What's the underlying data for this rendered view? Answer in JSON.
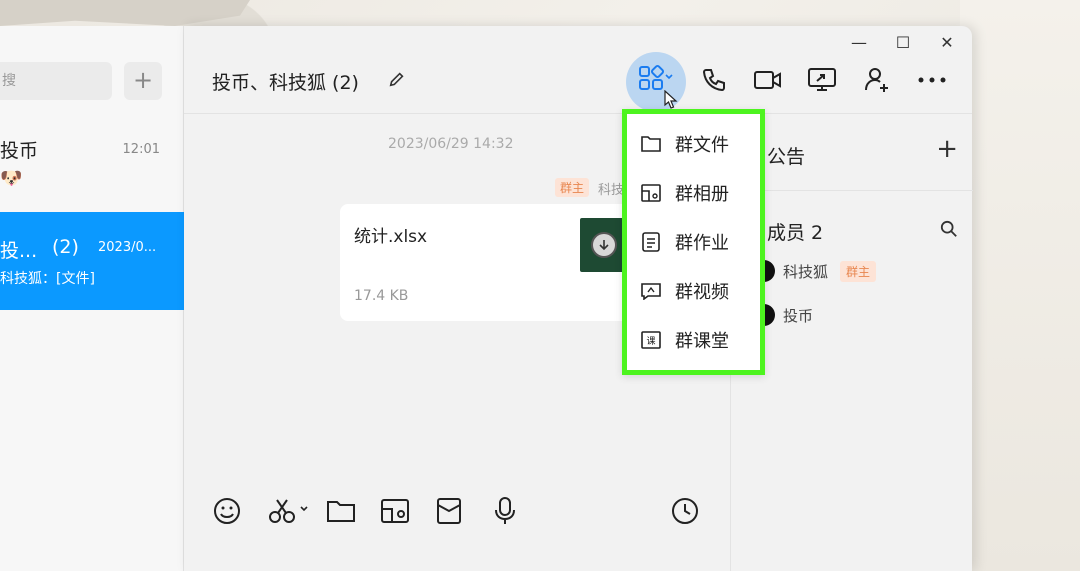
{
  "left_panel": {
    "search_placeholder": "搜",
    "add_label": "+",
    "conversations": [
      {
        "name": "投币",
        "time": "12:01",
        "preview": "",
        "emoji": "🐶"
      },
      {
        "name": "投...",
        "count": "(2)",
        "time": "2023/0...",
        "preview": "科技狐：[文件]"
      }
    ]
  },
  "window": {
    "controls": {
      "minimize": "—",
      "maximize": "☐",
      "close": "✕"
    }
  },
  "header": {
    "title": "投币、科技狐 (2)",
    "icons": [
      "apps-icon",
      "phone-icon",
      "video-icon",
      "screen-share-icon",
      "add-member-icon",
      "more-icon"
    ]
  },
  "messages": {
    "timestamp": "2023/06/29 14:32",
    "sender_badge": "群主",
    "sender_name": "科技",
    "file": {
      "name": "统计.xlsx",
      "size": "17.4 KB"
    }
  },
  "side_panel": {
    "notice_label": "公告",
    "notice_add": "+",
    "members_label": "成员 2",
    "members": [
      {
        "name": "科技狐",
        "badge": "群主"
      },
      {
        "name": "投币",
        "badge": ""
      }
    ]
  },
  "dropdown": {
    "items": [
      {
        "label": "群文件",
        "icon": "folder-icon"
      },
      {
        "label": "群相册",
        "icon": "album-icon"
      },
      {
        "label": "群作业",
        "icon": "homework-icon"
      },
      {
        "label": "群视频",
        "icon": "video-chat-icon"
      },
      {
        "label": "群课堂",
        "icon": "classroom-icon"
      }
    ],
    "highlight_color": "#4df41f"
  },
  "toolbar": {
    "icons": [
      "emoji-icon",
      "scissors-icon",
      "folder-icon",
      "image-icon",
      "red-packet-icon",
      "mic-icon",
      "history-icon"
    ]
  },
  "colors": {
    "accent": "#0b99ff",
    "badge_bg": "#fde3d6",
    "badge_text": "#e8864f"
  }
}
